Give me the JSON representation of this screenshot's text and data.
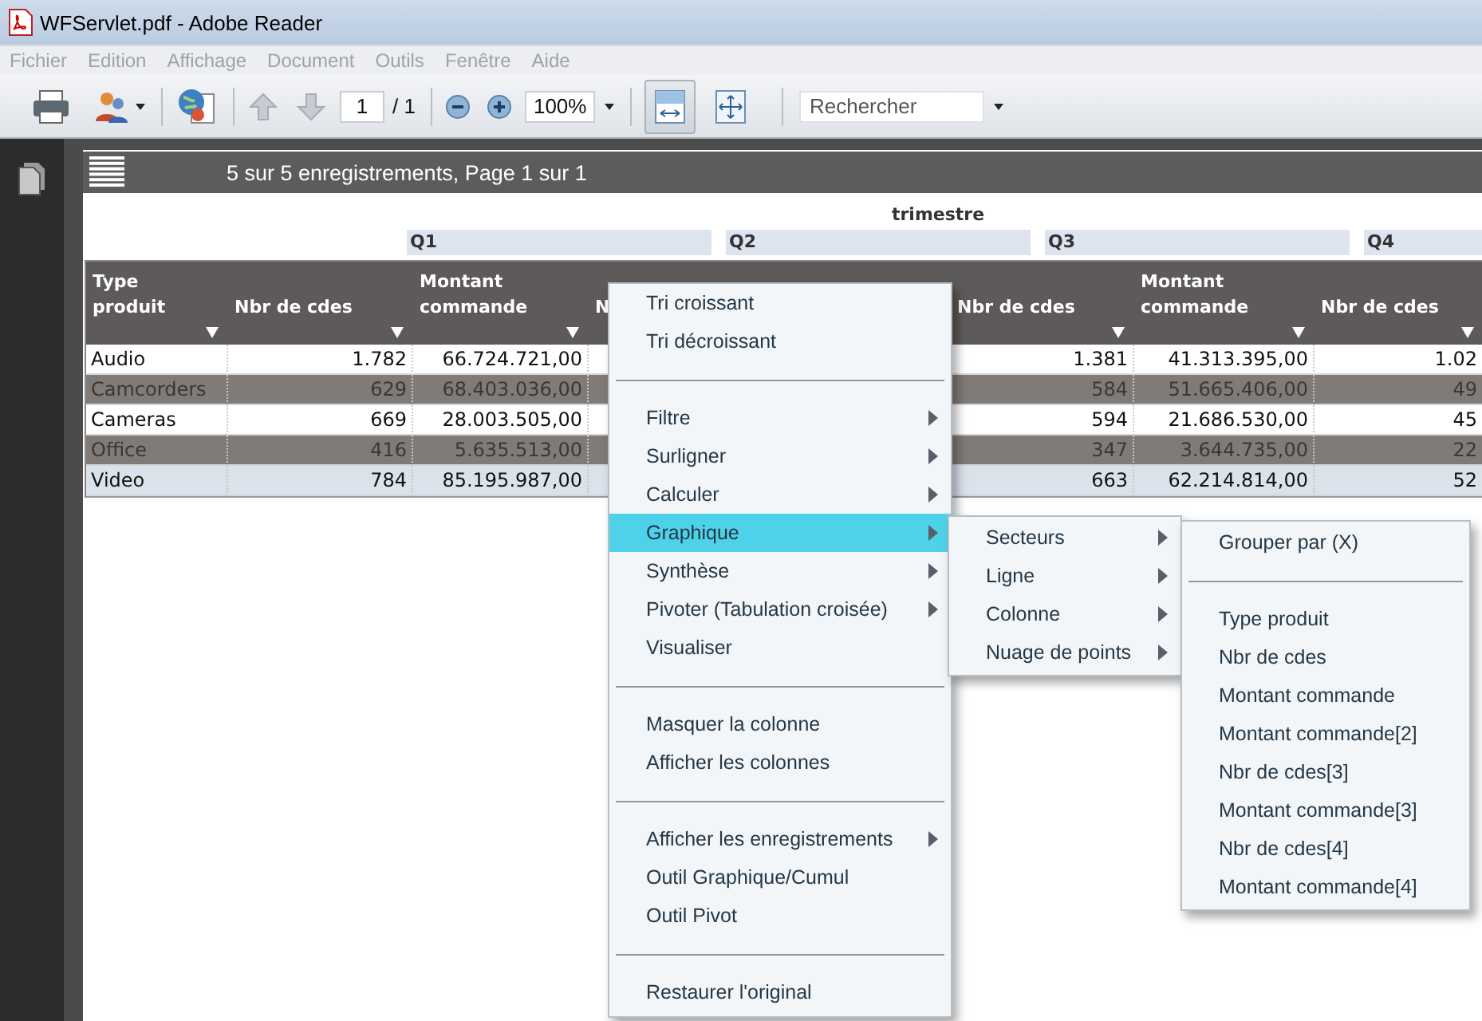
{
  "window": {
    "title": "WFServlet.pdf - Adobe Reader"
  },
  "menu_bar": {
    "disabled": true,
    "items": [
      "Fichier",
      "Edition",
      "Affichage",
      "Document",
      "Outils",
      "Fenêtre",
      "Aide"
    ]
  },
  "toolbar": {
    "previous_page": {
      "disabled": true
    },
    "next_page": {
      "disabled": true
    },
    "page": "1",
    "page_count": "/ 1",
    "zoom": "100%",
    "fit_width": {
      "selected": true
    },
    "fit_page": {
      "selected": false
    },
    "search": {
      "placeholder": "Rechercher"
    }
  },
  "report": {
    "status": "5 sur 5 enregistrements, Page 1 sur 1",
    "group_title": "trimestre",
    "quarters": [
      "Q1",
      "Q2",
      "Q3",
      "Q4"
    ],
    "columns": [
      {
        "label": "Type produit",
        "sort_arrow": true
      },
      {
        "label": "Nbr de cdes",
        "sort_arrow": true
      },
      {
        "label": "Montant commande",
        "sort_arrow": true
      },
      {
        "label": "N"
      },
      {
        "label": "Nbr de cdes",
        "sort_arrow": true
      },
      {
        "label": "Montant commande",
        "sort_arrow": true
      },
      {
        "label": "Nbr de cdes",
        "sort_arrow": true
      }
    ],
    "rows": [
      {
        "kind": "plain",
        "cells": [
          "Audio",
          "1.782",
          "66.724.721,00",
          "",
          "1.381",
          "41.313.395,00",
          "1.02"
        ]
      },
      {
        "kind": "shaded",
        "cells": [
          "Camcorders",
          "629",
          "68.403.036,00",
          "",
          "584",
          "51.665.406,00",
          "49"
        ]
      },
      {
        "kind": "plain",
        "cells": [
          "Cameras",
          "669",
          "28.003.505,00",
          "",
          "594",
          "21.686.530,00",
          "45"
        ]
      },
      {
        "kind": "shaded",
        "cells": [
          "Office",
          "416",
          "5.635.513,00",
          "",
          "347",
          "3.644.735,00",
          "22"
        ]
      },
      {
        "kind": "hover",
        "cells": [
          "Video",
          "784",
          "85.195.987,00",
          "",
          "663",
          "62.214.814,00",
          "52"
        ]
      }
    ]
  },
  "context_menu": {
    "items": [
      {
        "kind": "item",
        "label": "Tri croissant",
        "submenu": false,
        "selected": false
      },
      {
        "kind": "item",
        "label": "Tri décroissant",
        "submenu": false,
        "selected": false
      },
      {
        "kind": "separator"
      },
      {
        "kind": "item",
        "label": "Filtre",
        "submenu": true,
        "selected": false
      },
      {
        "kind": "item",
        "label": "Surligner",
        "submenu": true,
        "selected": false
      },
      {
        "kind": "item",
        "label": "Calculer",
        "submenu": true,
        "selected": false
      },
      {
        "kind": "item",
        "label": "Graphique",
        "submenu": true,
        "selected": true
      },
      {
        "kind": "item",
        "label": "Synthèse",
        "submenu": true,
        "selected": false
      },
      {
        "kind": "item",
        "label": "Pivoter (Tabulation croisée)",
        "submenu": true,
        "selected": false
      },
      {
        "kind": "item",
        "label": "Visualiser",
        "submenu": false,
        "selected": false
      },
      {
        "kind": "separator"
      },
      {
        "kind": "item",
        "label": "Masquer la colonne",
        "submenu": false,
        "selected": false
      },
      {
        "kind": "item",
        "label": "Afficher les colonnes",
        "submenu": false,
        "selected": false
      },
      {
        "kind": "separator"
      },
      {
        "kind": "item",
        "label": "Afficher les enregistrements",
        "submenu": true,
        "selected": false
      },
      {
        "kind": "item",
        "label": "Outil Graphique/Cumul",
        "submenu": false,
        "selected": false
      },
      {
        "kind": "item",
        "label": "Outil Pivot",
        "submenu": false,
        "selected": false
      },
      {
        "kind": "separator"
      },
      {
        "kind": "item",
        "label": "Restaurer l'original",
        "submenu": false,
        "selected": false
      }
    ]
  },
  "chart_menu": {
    "items": [
      {
        "kind": "item",
        "label": "Secteurs",
        "submenu": true,
        "selected": false
      },
      {
        "kind": "item",
        "label": "Ligne",
        "submenu": true,
        "selected": false
      },
      {
        "kind": "item",
        "label": "Colonne",
        "submenu": true,
        "selected": false
      },
      {
        "kind": "item",
        "label": "Nuage de points",
        "submenu": true,
        "selected": false
      }
    ]
  },
  "field_menu": {
    "items": [
      {
        "kind": "item",
        "label": "Grouper par (X)",
        "submenu": false,
        "selected": false
      },
      {
        "kind": "separator"
      },
      {
        "kind": "item",
        "label": "Type produit",
        "submenu": false,
        "selected": false
      },
      {
        "kind": "item",
        "label": "Nbr de cdes",
        "submenu": false,
        "selected": false
      },
      {
        "kind": "item",
        "label": "Montant commande",
        "submenu": false,
        "selected": false
      },
      {
        "kind": "item",
        "label": "Montant commande[2]",
        "submenu": false,
        "selected": false
      },
      {
        "kind": "item",
        "label": "Nbr de cdes[3]",
        "submenu": false,
        "selected": false
      },
      {
        "kind": "item",
        "label": "Montant commande[3]",
        "submenu": false,
        "selected": false
      },
      {
        "kind": "item",
        "label": "Nbr de cdes[4]",
        "submenu": false,
        "selected": false
      },
      {
        "kind": "item",
        "label": "Montant commande[4]",
        "submenu": false,
        "selected": false
      }
    ]
  }
}
